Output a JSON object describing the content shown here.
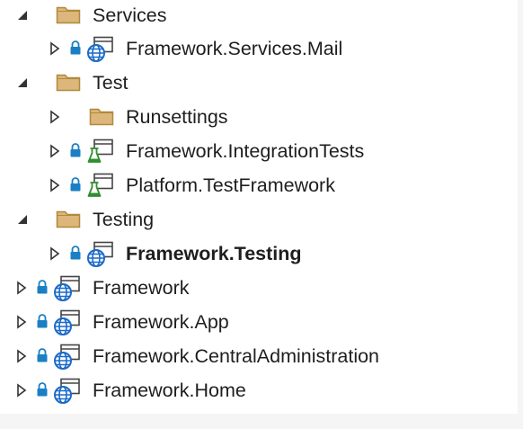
{
  "tree": {
    "items": [
      {
        "label": "Services",
        "kind": "folder",
        "expanded": true,
        "bold": false
      },
      {
        "label": "Framework.Services.Mail",
        "kind": "web-project",
        "locked": true,
        "bold": false
      },
      {
        "label": "Test",
        "kind": "folder",
        "expanded": true,
        "bold": false
      },
      {
        "label": "Runsettings",
        "kind": "folder",
        "expanded": false,
        "bold": false
      },
      {
        "label": "Framework.IntegrationTests",
        "kind": "test-project",
        "locked": true,
        "bold": false
      },
      {
        "label": "Platform.TestFramework",
        "kind": "test-project",
        "locked": true,
        "bold": false
      },
      {
        "label": "Testing",
        "kind": "folder",
        "expanded": true,
        "bold": false
      },
      {
        "label": "Framework.Testing",
        "kind": "web-project",
        "locked": true,
        "bold": true
      },
      {
        "label": "Framework",
        "kind": "web-project",
        "locked": true,
        "bold": false
      },
      {
        "label": "Framework.App",
        "kind": "web-project",
        "locked": true,
        "bold": false
      },
      {
        "label": "Framework.CentralAdministration",
        "kind": "web-project",
        "locked": true,
        "bold": false
      },
      {
        "label": "Framework.Home",
        "kind": "web-project",
        "locked": true,
        "bold": false
      }
    ]
  },
  "colors": {
    "text": "#1e1e1e",
    "folder_fill": "#dcb67a",
    "folder_stroke": "#b08a3a",
    "globe": "#1b6ac9",
    "lock": "#1b7fc4",
    "flask": "#2f8f2f",
    "arrow": "#333333"
  },
  "icons": {
    "expanded": "expanded-triangle-icon",
    "collapsed": "collapsed-triangle-icon",
    "folder": "folder-icon",
    "lock": "lock-icon",
    "web_project": "web-project-icon",
    "test_project": "test-project-icon"
  }
}
